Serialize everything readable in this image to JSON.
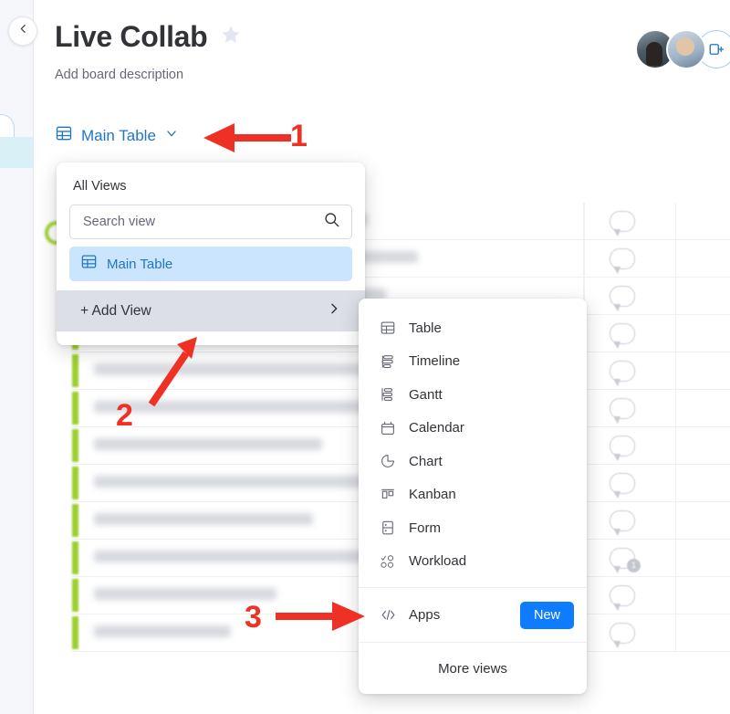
{
  "app": {
    "collapse_icon": "chevron-left-icon"
  },
  "header": {
    "board_title": "Live Collab",
    "favorite_icon": "star-icon",
    "board_description": "Add board description",
    "avatars": [
      "avatar-person-1",
      "avatar-person-2"
    ],
    "invite_icon": "invite-member-icon"
  },
  "view_switcher": {
    "icon": "table-view-icon",
    "label": "Main Table",
    "chevron_icon": "chevron-down-icon"
  },
  "views_panel": {
    "heading": "All Views",
    "search": {
      "placeholder": "Search view",
      "value": "",
      "icon": "search-icon"
    },
    "views": [
      {
        "label": "Main Table",
        "icon": "table-view-icon",
        "selected": true
      }
    ],
    "add_view": {
      "label": "+ Add View",
      "chevron_icon": "chevron-right-icon"
    }
  },
  "add_view_submenu": {
    "items": [
      {
        "label": "Table",
        "icon": "table-icon"
      },
      {
        "label": "Timeline",
        "icon": "timeline-icon"
      },
      {
        "label": "Gantt",
        "icon": "gantt-icon"
      },
      {
        "label": "Calendar",
        "icon": "calendar-icon"
      },
      {
        "label": "Chart",
        "icon": "chart-pie-icon"
      },
      {
        "label": "Kanban",
        "icon": "kanban-icon"
      },
      {
        "label": "Form",
        "icon": "form-icon"
      },
      {
        "label": "Workload",
        "icon": "workload-icon"
      }
    ],
    "apps": {
      "label": "Apps",
      "icon": "code-brackets-icon",
      "badge_label": "New"
    },
    "more_views_label": "More views"
  },
  "board_table": {
    "group_status_icon": "group-status-icon",
    "rows": [
      {
        "comment_icon": "comment-bubble-icon",
        "comment_count": ""
      },
      {
        "comment_icon": "comment-bubble-icon",
        "comment_count": ""
      },
      {
        "comment_icon": "comment-bubble-icon",
        "comment_count": ""
      },
      {
        "comment_icon": "comment-bubble-icon",
        "comment_count": ""
      },
      {
        "comment_icon": "comment-bubble-icon",
        "comment_count": ""
      },
      {
        "comment_icon": "comment-bubble-icon",
        "comment_count": ""
      },
      {
        "comment_icon": "comment-bubble-icon",
        "comment_count": ""
      },
      {
        "comment_icon": "comment-bubble-icon",
        "comment_count": ""
      },
      {
        "comment_icon": "comment-bubble-icon",
        "comment_count": ""
      },
      {
        "comment_icon": "comment-bubble-icon",
        "comment_count": "1"
      },
      {
        "comment_icon": "comment-bubble-icon",
        "comment_count": ""
      },
      {
        "comment_icon": "comment-bubble-icon",
        "comment_count": ""
      }
    ]
  },
  "annotations": {
    "color": "#EE3124",
    "steps": [
      {
        "number": "1",
        "points_to": "view-switcher-chevron",
        "direction": "left"
      },
      {
        "number": "2",
        "points_to": "add-view-row",
        "direction": "up-right"
      },
      {
        "number": "3",
        "points_to": "apps-row",
        "direction": "right"
      }
    ]
  }
}
